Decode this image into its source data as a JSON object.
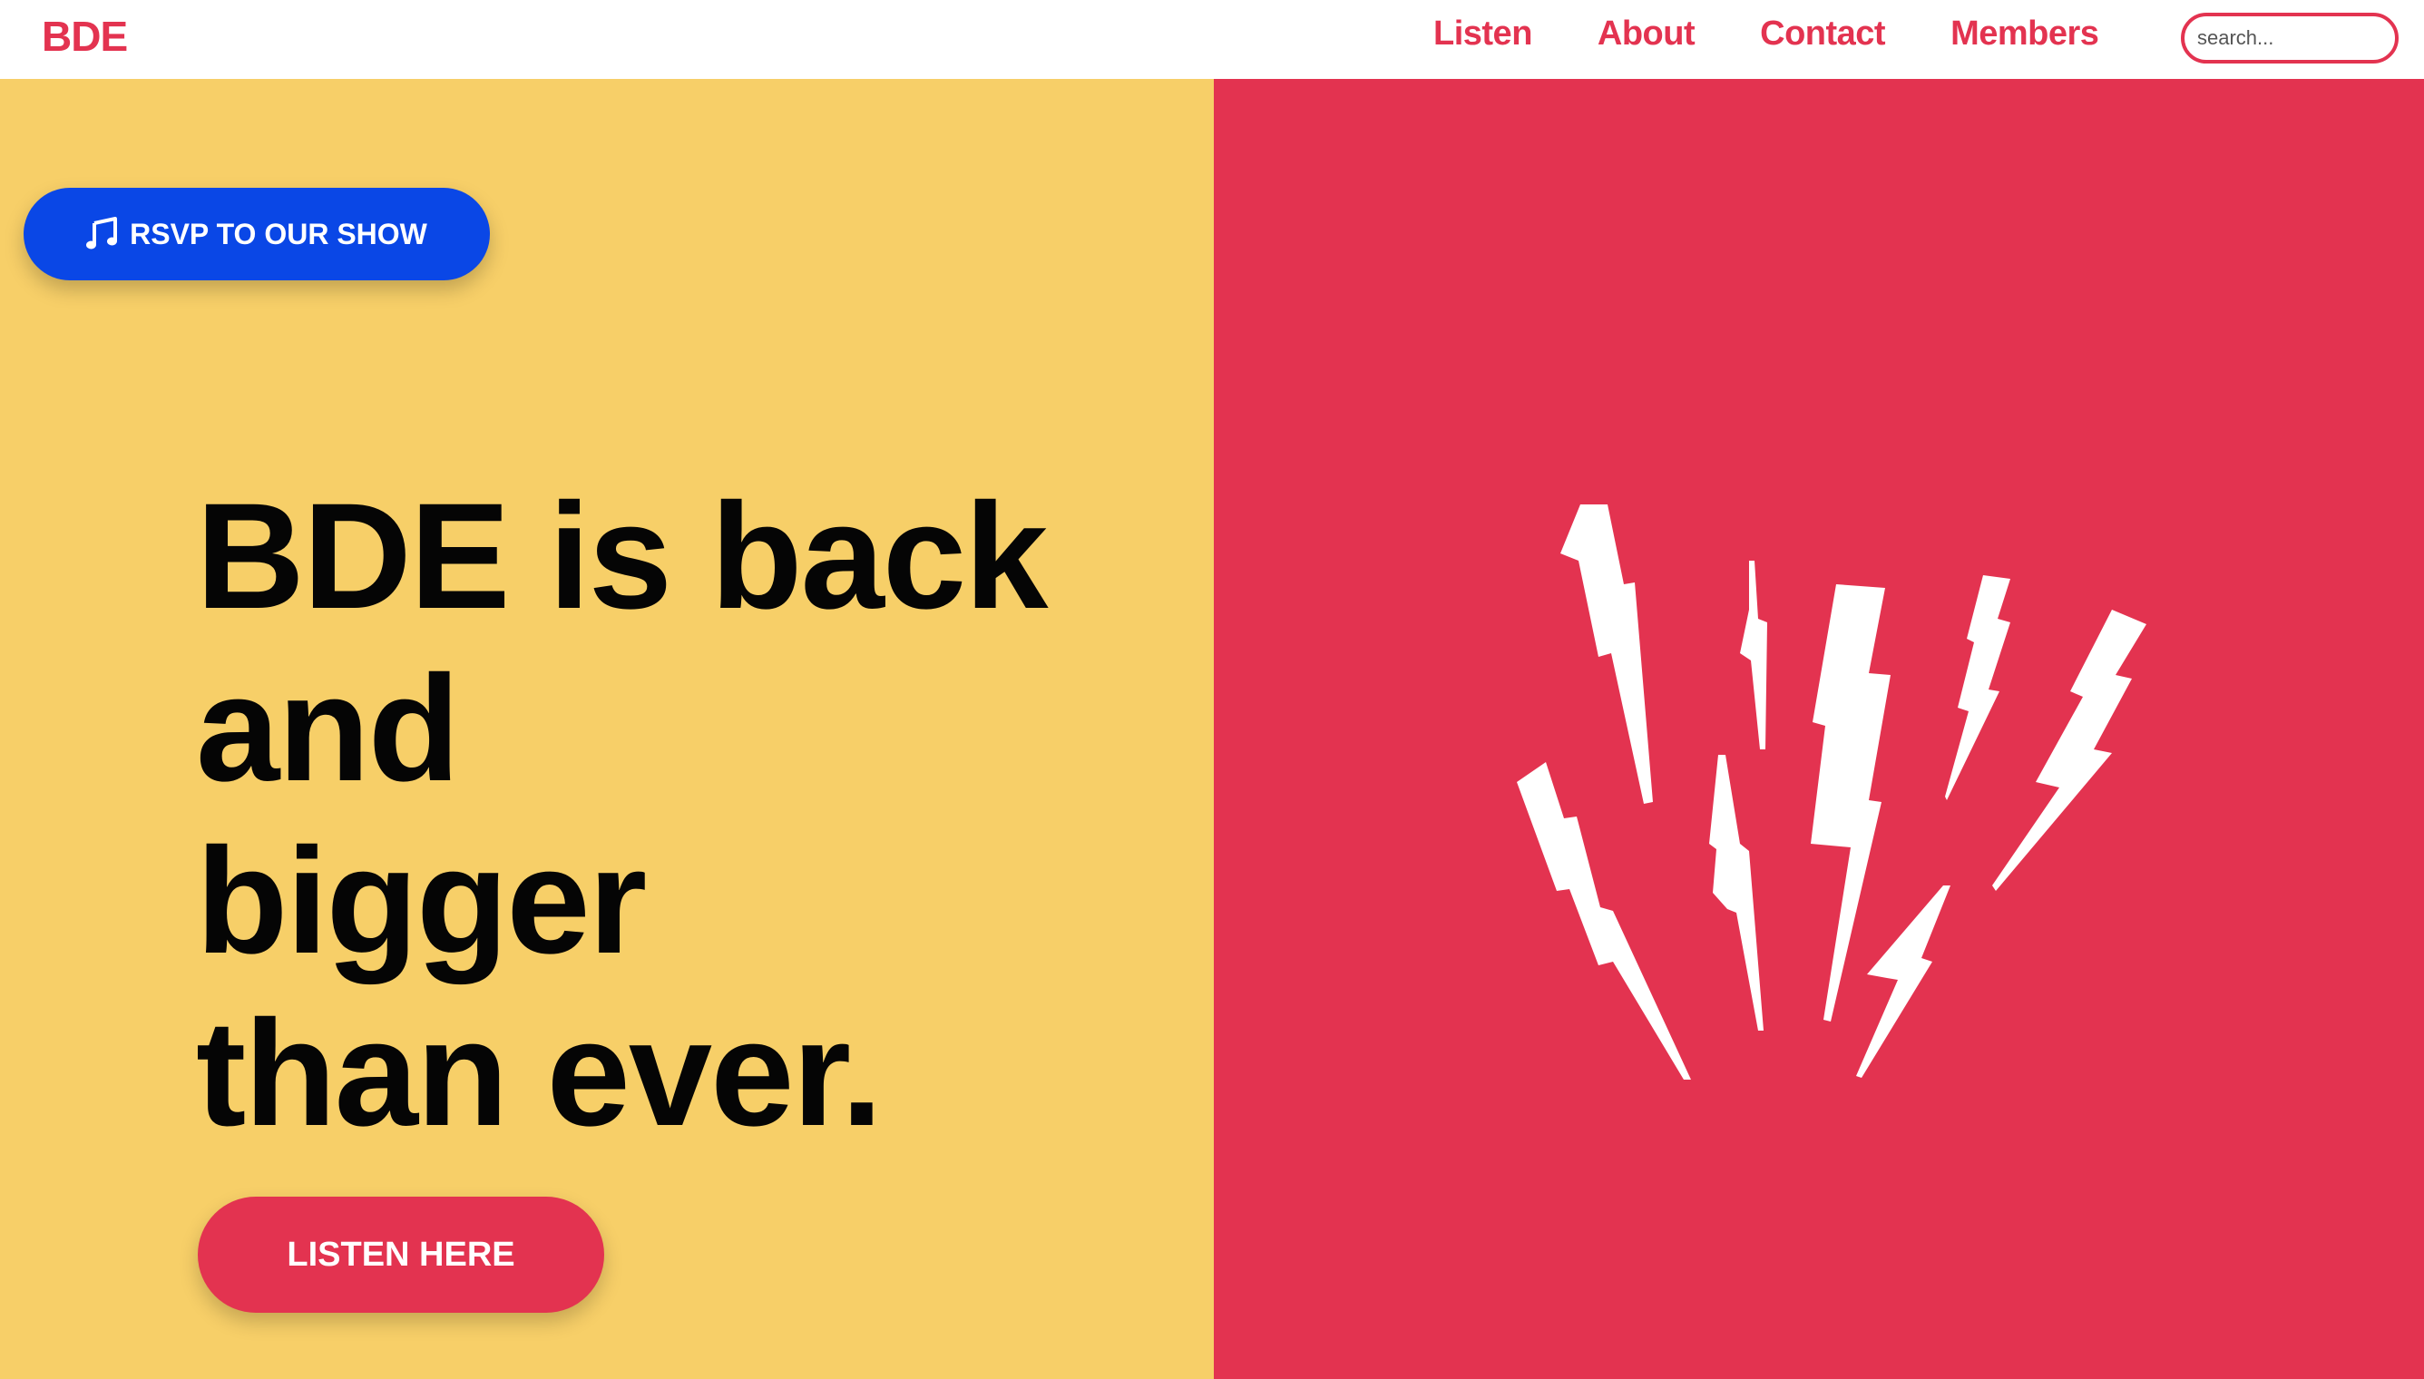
{
  "header": {
    "logo": "BDE",
    "nav": [
      "Listen",
      "About",
      "Contact",
      "Members"
    ],
    "search_placeholder": "search..."
  },
  "hero": {
    "rsvp_label": "RSVP TO OUR SHOW",
    "rsvp_icon": "music-note-icon",
    "title_lines": [
      "BDE is back",
      "and",
      "bigger",
      "than ever."
    ],
    "listen_label": "LISTEN HERE",
    "illustration_icon": "lightning-bolts-icon"
  },
  "colors": {
    "brand_red": "#e33350",
    "yellow_panel": "#f7cf68",
    "rsvp_blue": "#0a47e6",
    "title_text": "#050505"
  }
}
